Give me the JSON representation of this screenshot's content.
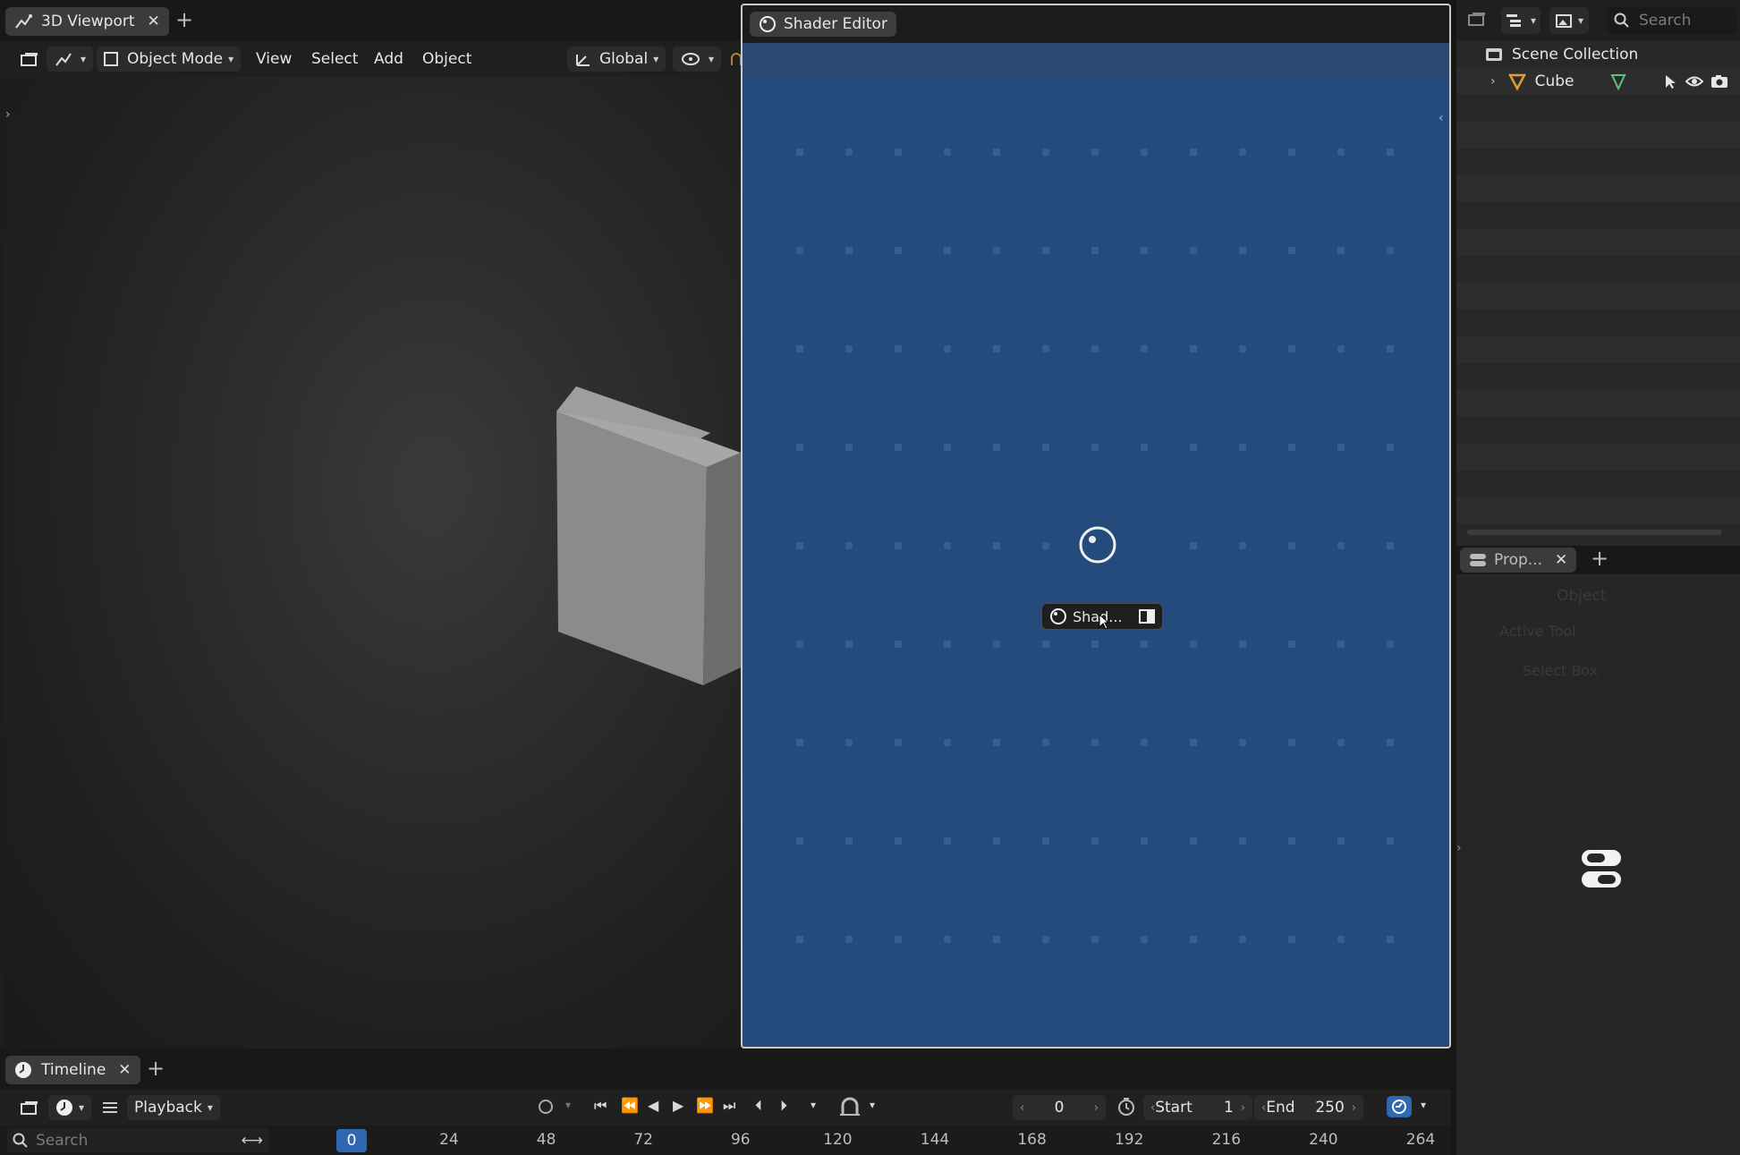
{
  "colors": {
    "accent": "#2f67b1",
    "shader_overlay": "#244b7c",
    "cube": "#8b8b8b"
  },
  "viewport": {
    "tab_label": "3D Viewport",
    "mode": "Object Mode",
    "menus": [
      "View",
      "Select",
      "Add",
      "Object"
    ],
    "orientation": "Global"
  },
  "shader_editor": {
    "tab_label": "Shader Editor",
    "drag_label": "Shad..."
  },
  "outliner": {
    "search_placeholder": "Search",
    "collection": "Scene Collection",
    "object": "Cube"
  },
  "properties": {
    "tab_label": "Prop...",
    "ghost_mode": "Object",
    "ghost_section": "Active Tool",
    "ghost_tool": "Select Box"
  },
  "timeline": {
    "tab_label": "Timeline",
    "playback_label": "Playback",
    "current_frame": "0",
    "start_label": "Start",
    "start_value": "1",
    "end_label": "End",
    "end_value": "250",
    "search_placeholder": "Search",
    "ruler_current": "0",
    "ruler_ticks": [
      "24",
      "48",
      "72",
      "96",
      "120",
      "144",
      "168",
      "192",
      "216",
      "240",
      "264"
    ]
  }
}
